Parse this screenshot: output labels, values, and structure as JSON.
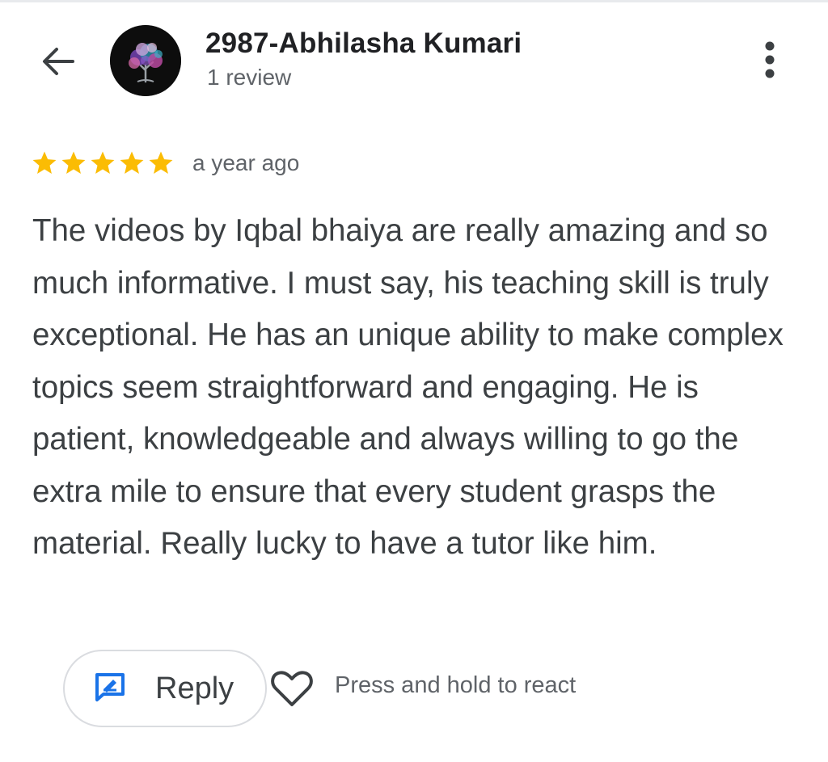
{
  "header": {
    "back_icon": "arrow-left-icon",
    "author_name": "2987-Abhilasha Kumari",
    "review_count": "1 review",
    "more_icon": "more-vertical-icon"
  },
  "review": {
    "rating": 5,
    "rating_max": 5,
    "star_color": "#fbbc04",
    "date": "a year ago",
    "text": "The videos by Iqbal bhaiya are really amazing and so much informative. I must say, his teaching skill is truly exceptional. He has an unique ability to make complex topics seem straightforward and engaging. He is patient, knowledgeable and always willing to go the extra mile to ensure that every student grasps the material. Really lucky to have a tutor like him."
  },
  "actions": {
    "reply_label": "Reply",
    "reply_icon": "reply-icon",
    "accent_color": "#1a73e8",
    "heart_icon": "heart-outline-icon",
    "react_hint": "Press and hold to react"
  }
}
